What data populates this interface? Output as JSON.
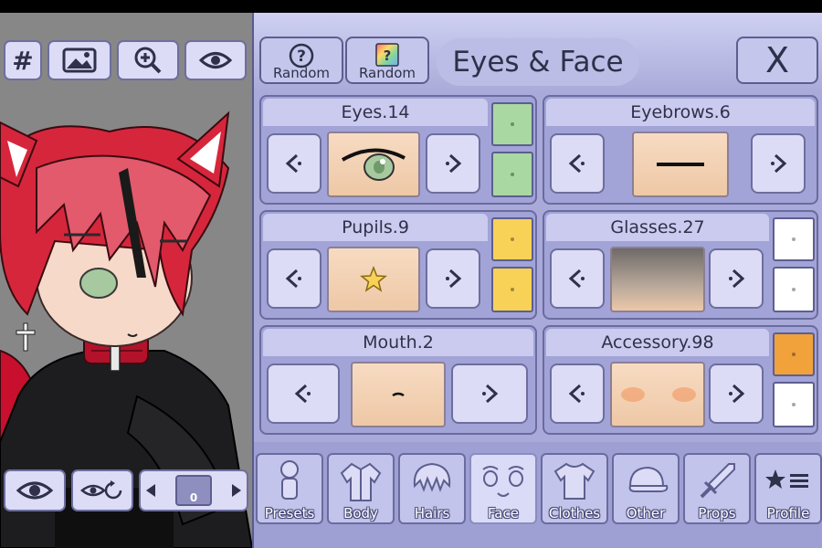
{
  "header": {
    "random_label_1": "Random",
    "random_label_2": "Random",
    "title": "Eyes & Face",
    "close_label": "X",
    "random_icon_1": "question-mark-icon",
    "random_icon_2": "rainbow-question-icon"
  },
  "left_toolbar": {
    "hash_label": "#",
    "icons": [
      "hash-icon",
      "image-icon",
      "zoom-in-icon",
      "eye-icon"
    ]
  },
  "bottom_left": {
    "icons": [
      "eye-icon",
      "eye-rotate-icon",
      "prev-arrow-icon",
      "character-slot-icon",
      "next-arrow-icon"
    ],
    "slot_number": "0"
  },
  "cards": [
    {
      "label": "Eyes.14",
      "swatches": [
        "#a9d8a3",
        "#a9d8a3"
      ]
    },
    {
      "label": "Eyebrows.6",
      "swatches": []
    },
    {
      "label": "Pupils.9",
      "swatches": [
        "#f7d257",
        "#f7d257"
      ]
    },
    {
      "label": "Glasses.27",
      "swatches": [
        "#ffffff",
        "#ffffff"
      ]
    },
    {
      "label": "Mouth.2",
      "swatches": []
    },
    {
      "label": "Accessory.98",
      "swatches": [
        "#f1a23b",
        "#ffffff"
      ]
    }
  ],
  "tabs": [
    {
      "label": "Presets",
      "icon": "preset-figure-icon"
    },
    {
      "label": "Body",
      "icon": "jacket-icon"
    },
    {
      "label": "Hairs",
      "icon": "hair-icon"
    },
    {
      "label": "Face",
      "icon": "face-icon",
      "active": true
    },
    {
      "label": "Clothes",
      "icon": "tshirt-icon"
    },
    {
      "label": "Other",
      "icon": "cap-icon"
    },
    {
      "label": "Props",
      "icon": "sword-icon"
    },
    {
      "label": "Profile",
      "icon": "star-list-icon"
    }
  ],
  "colors": {
    "panel": "#a9aad9",
    "button": "#dcdcf6",
    "hair": "#d6263c",
    "eye_green": "#a9d8a3",
    "pupil_yellow": "#f7d257",
    "accessory_orange": "#f1a23b"
  }
}
